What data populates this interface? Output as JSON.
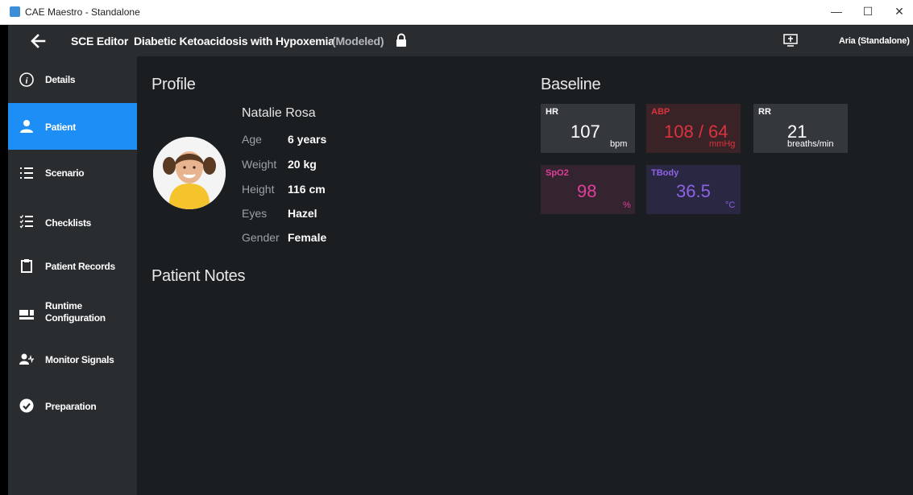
{
  "window": {
    "title": "CAE Maestro - Standalone",
    "controls": {
      "minimize": "—",
      "maximize": "☐",
      "close": "✕"
    }
  },
  "header": {
    "editor_label": "SCE Editor",
    "scenario_title": "Diabetic Ketoacidosis with Hypoxemia",
    "status": "(Modeled)",
    "user": "Aria (Standalone)"
  },
  "sidebar": {
    "active_color": "#1c8ef5",
    "items": [
      {
        "label": "Details",
        "icon": "info-icon"
      },
      {
        "label": "Patient",
        "icon": "person-icon",
        "active": true
      },
      {
        "label": "Scenario",
        "icon": "list-icon"
      },
      {
        "label": "Checklists",
        "icon": "checklist-icon"
      },
      {
        "label": "Patient Records",
        "icon": "clipboard-icon"
      },
      {
        "label": "Runtime",
        "label2": "Configuration",
        "icon": "layout-icon"
      },
      {
        "label": "Monitor Signals",
        "icon": "person-signal-icon"
      },
      {
        "label": "Preparation",
        "icon": "check-circle-icon"
      }
    ]
  },
  "profile": {
    "title": "Profile",
    "name": "Natalie Rosa",
    "attributes": [
      {
        "label": "Age",
        "value": "6 years"
      },
      {
        "label": "Weight",
        "value": "20 kg"
      },
      {
        "label": "Height",
        "value": "116 cm"
      },
      {
        "label": "Eyes",
        "value": "Hazel"
      },
      {
        "label": "Gender",
        "value": "Female"
      }
    ]
  },
  "notes": {
    "title": "Patient Notes"
  },
  "baseline": {
    "title": "Baseline",
    "vitals": [
      {
        "label": "HR",
        "value": "107",
        "unit": "bpm",
        "color": "#ffffff",
        "bg": "#34373b"
      },
      {
        "label": "ABP",
        "value": "108 / 64",
        "unit": "mmHg",
        "color": "#d9333f",
        "bg": "#3a2326"
      },
      {
        "label": "RR",
        "value": "21",
        "unit": "breaths/min",
        "color": "#ffffff",
        "bg": "#34373b"
      },
      {
        "label": "SpO2",
        "value": "98",
        "unit": "%",
        "color": "#e03e9b",
        "bg": "#33242f"
      },
      {
        "label": "TBody",
        "value": "36.5",
        "unit": "°C",
        "color": "#8f62e6",
        "bg": "#292741"
      }
    ]
  }
}
